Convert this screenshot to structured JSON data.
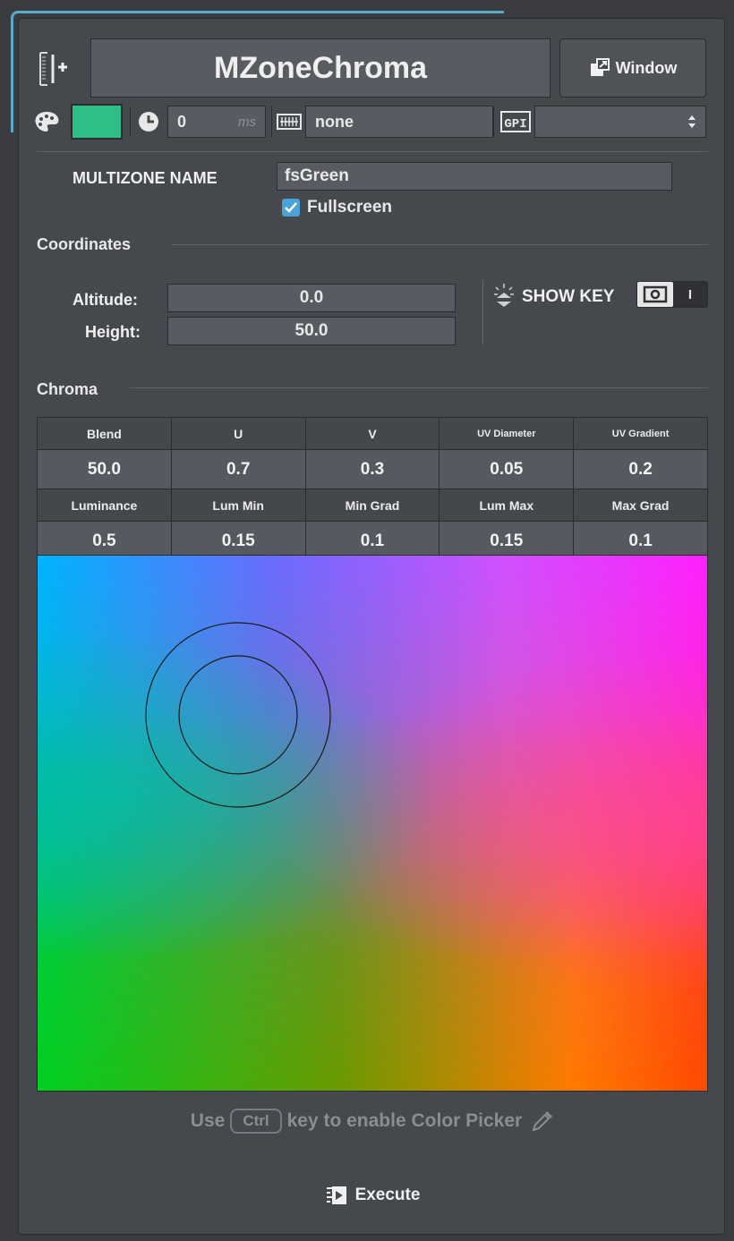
{
  "header": {
    "title": "MZoneChroma",
    "window_label": "Window",
    "icons": {
      "add_layer": "add-layer-icon",
      "window": "window-icon"
    }
  },
  "toolbar": {
    "color_swatch": "#2fbf86",
    "delay_value": "0",
    "delay_unit": "ms",
    "keyboard_value": "none",
    "gpi_label": "GPI",
    "gpi_select_value": ""
  },
  "multizone": {
    "name_label": "MULTIZONE NAME",
    "name_value": "fsGreen",
    "fullscreen_label": "Fullscreen",
    "fullscreen_checked": true
  },
  "coordinates": {
    "section_label": "Coordinates",
    "altitude_label": "Altitude:",
    "altitude_value": "0.0",
    "height_label": "Height:",
    "height_value": "50.0",
    "show_key_label": "SHOW KEY",
    "toggle_label": "I"
  },
  "chroma": {
    "section_label": "Chroma",
    "headers_row1": [
      "Blend",
      "U",
      "V",
      "UV Diameter",
      "UV Gradient"
    ],
    "values_row1": [
      "50.0",
      "0.7",
      "0.3",
      "0.05",
      "0.2"
    ],
    "headers_row2": [
      "Luminance",
      "Lum Min",
      "Min Grad",
      "Lum Max",
      "Max Grad"
    ],
    "values_row2": [
      "0.5",
      "0.15",
      "0.1",
      "0.15",
      "0.1"
    ]
  },
  "footer": {
    "hint_pre": "Use",
    "hint_key": "Ctrl",
    "hint_post": "key to enable Color Picker",
    "execute_label": "Execute"
  },
  "colors": {
    "panel_bg": "#45484d",
    "field_bg": "#585c62",
    "accent_check": "#4aa3d8",
    "swatch": "#2fbf86"
  }
}
